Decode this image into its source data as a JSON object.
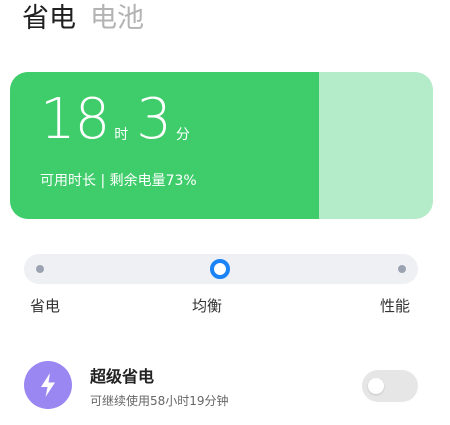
{
  "tabs": [
    {
      "label": "省电",
      "active": true
    },
    {
      "label": "电池",
      "active": false
    }
  ],
  "battery_card": {
    "hours": "18",
    "hours_unit": "时",
    "minutes": "3",
    "minutes_unit": "分",
    "subtitle": "可用时长 | 剩余电量73%",
    "level_percent": 73,
    "fill_color": "#3ecd6a",
    "empty_color": "#b4ebc8"
  },
  "mode_slider": {
    "options": [
      "省电",
      "均衡",
      "性能"
    ],
    "selected": "均衡",
    "accent_color": "#1a83f5"
  },
  "super_saver": {
    "icon": "lightning-bolt-icon",
    "title": "超级省电",
    "subtitle": "可继续使用58小时19分钟",
    "enabled": false,
    "icon_color": "#9b87f2"
  }
}
